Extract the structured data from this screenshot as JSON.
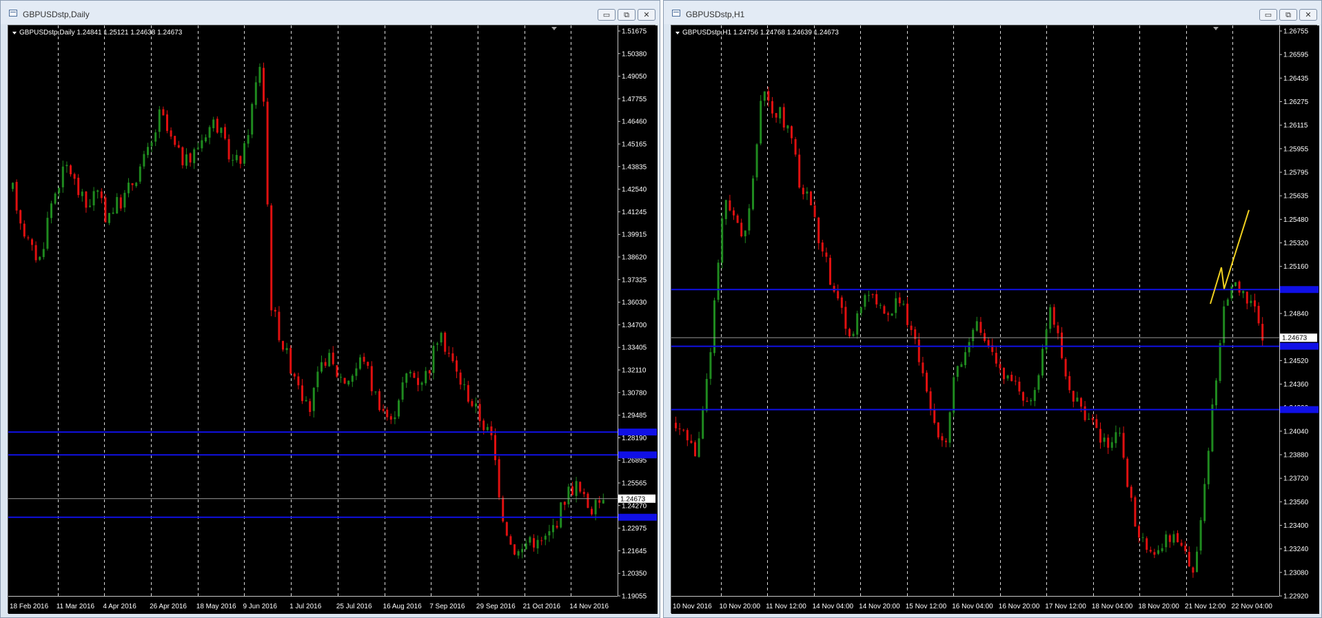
{
  "windows": [
    {
      "id": "left",
      "title": "GBPUSDstp,Daily",
      "info": "GBPUSDstp,Daily  1.24841 1.25121 1.24638 1.24673",
      "controls": {
        "minimize": "▭",
        "restore": "⧉",
        "close": "✕"
      },
      "price_axis": [
        "1.51675",
        "1.50380",
        "1.49050",
        "1.47755",
        "1.46460",
        "1.45165",
        "1.43835",
        "1.42540",
        "1.41245",
        "1.39915",
        "1.38620",
        "1.37325",
        "1.36030",
        "1.34700",
        "1.33405",
        "1.32110",
        "1.30780",
        "1.29485",
        "1.28190",
        "1.26895",
        "1.25565",
        "1.24270",
        "1.22975",
        "1.21645",
        "1.20350",
        "1.19055"
      ],
      "current_price": "1.24673",
      "time_axis": [
        "18 Feb 2016",
        "11 Mar 2016",
        "4 Apr 2016",
        "26 Apr 2016",
        "18 May 2016",
        "9 Jun 2016",
        "1 Jul 2016",
        "25 Jul 2016",
        "16 Aug 2016",
        "7 Sep 2016",
        "29 Sep 2016",
        "21 Oct 2016",
        "14 Nov 2016"
      ]
    },
    {
      "id": "right",
      "title": "GBPUSDstp,H1",
      "info": "GBPUSDstp,H1  1.24756 1.24768 1.24639 1.24673",
      "controls": {
        "minimize": "▭",
        "restore": "⧉",
        "close": "✕"
      },
      "price_axis": [
        "1.26755",
        "1.26595",
        "1.26435",
        "1.26275",
        "1.26115",
        "1.25955",
        "1.25795",
        "1.25635",
        "1.25480",
        "1.25320",
        "1.25160",
        "1.25000",
        "1.24840",
        "1.24680",
        "1.24520",
        "1.24360",
        "1.24200",
        "1.24040",
        "1.23880",
        "1.23720",
        "1.23560",
        "1.23400",
        "1.23240",
        "1.23080",
        "1.22920"
      ],
      "current_price": "1.24673",
      "time_axis": [
        "10 Nov 2016",
        "10 Nov 20:00",
        "11 Nov 12:00",
        "14 Nov 04:00",
        "14 Nov 20:00",
        "15 Nov 12:00",
        "16 Nov 04:00",
        "16 Nov 20:00",
        "17 Nov 12:00",
        "18 Nov 04:00",
        "18 Nov 20:00",
        "21 Nov 12:00",
        "22 Nov 04:00"
      ]
    }
  ],
  "colors": {
    "bull": "#1f8a1f",
    "bear": "#e01010",
    "level": "#1010e6",
    "arrow": "#f0d020",
    "background": "#000000"
  },
  "chart_data": [
    {
      "type": "candlestick",
      "symbol": "GBPUSDstp",
      "timeframe": "Daily",
      "ylim": [
        1.19055,
        1.51675
      ],
      "horizontal_levels": [
        1.2852,
        1.272,
        1.236
      ],
      "current_price": 1.24673,
      "path": [
        1.425,
        1.405,
        1.39,
        1.385,
        1.415,
        1.43,
        1.44,
        1.425,
        1.415,
        1.425,
        1.41,
        1.415,
        1.42,
        1.43,
        1.44,
        1.45,
        1.47,
        1.455,
        1.445,
        1.44,
        1.45,
        1.46,
        1.465,
        1.45,
        1.44,
        1.445,
        1.475,
        1.505,
        1.36,
        1.34,
        1.325,
        1.315,
        1.295,
        1.315,
        1.33,
        1.32,
        1.315,
        1.32,
        1.33,
        1.31,
        1.3,
        1.29,
        1.31,
        1.32,
        1.315,
        1.32,
        1.34,
        1.335,
        1.32,
        1.31,
        1.3,
        1.29,
        1.28,
        1.24,
        1.22,
        1.215,
        1.225,
        1.22,
        1.225,
        1.235,
        1.25,
        1.255,
        1.245,
        1.24,
        1.25
      ]
    },
    {
      "type": "candlestick",
      "symbol": "GBPUSDstp",
      "timeframe": "H1",
      "ylim": [
        1.2292,
        1.26755
      ],
      "horizontal_levels": [
        1.25,
        1.24615,
        1.24185
      ],
      "current_price": 1.24673,
      "projection": [
        [
          1.24905,
          1.2515
        ],
        [
          1.25005,
          1.2554
        ]
      ],
      "path": [
        1.241,
        1.24,
        1.239,
        1.242,
        1.249,
        1.256,
        1.255,
        1.253,
        1.257,
        1.264,
        1.262,
        1.262,
        1.26,
        1.257,
        1.256,
        1.253,
        1.251,
        1.249,
        1.247,
        1.248,
        1.25,
        1.249,
        1.248,
        1.25,
        1.248,
        1.246,
        1.243,
        1.241,
        1.239,
        1.244,
        1.246,
        1.248,
        1.247,
        1.246,
        1.244,
        1.244,
        1.243,
        1.242,
        1.245,
        1.249,
        1.246,
        1.243,
        1.242,
        1.241,
        1.24,
        1.239,
        1.241,
        1.236,
        1.234,
        1.232,
        1.232,
        1.233,
        1.233,
        1.232,
        1.231,
        1.237,
        1.243,
        1.249,
        1.2505,
        1.25,
        1.249,
        1.247
      ]
    }
  ]
}
